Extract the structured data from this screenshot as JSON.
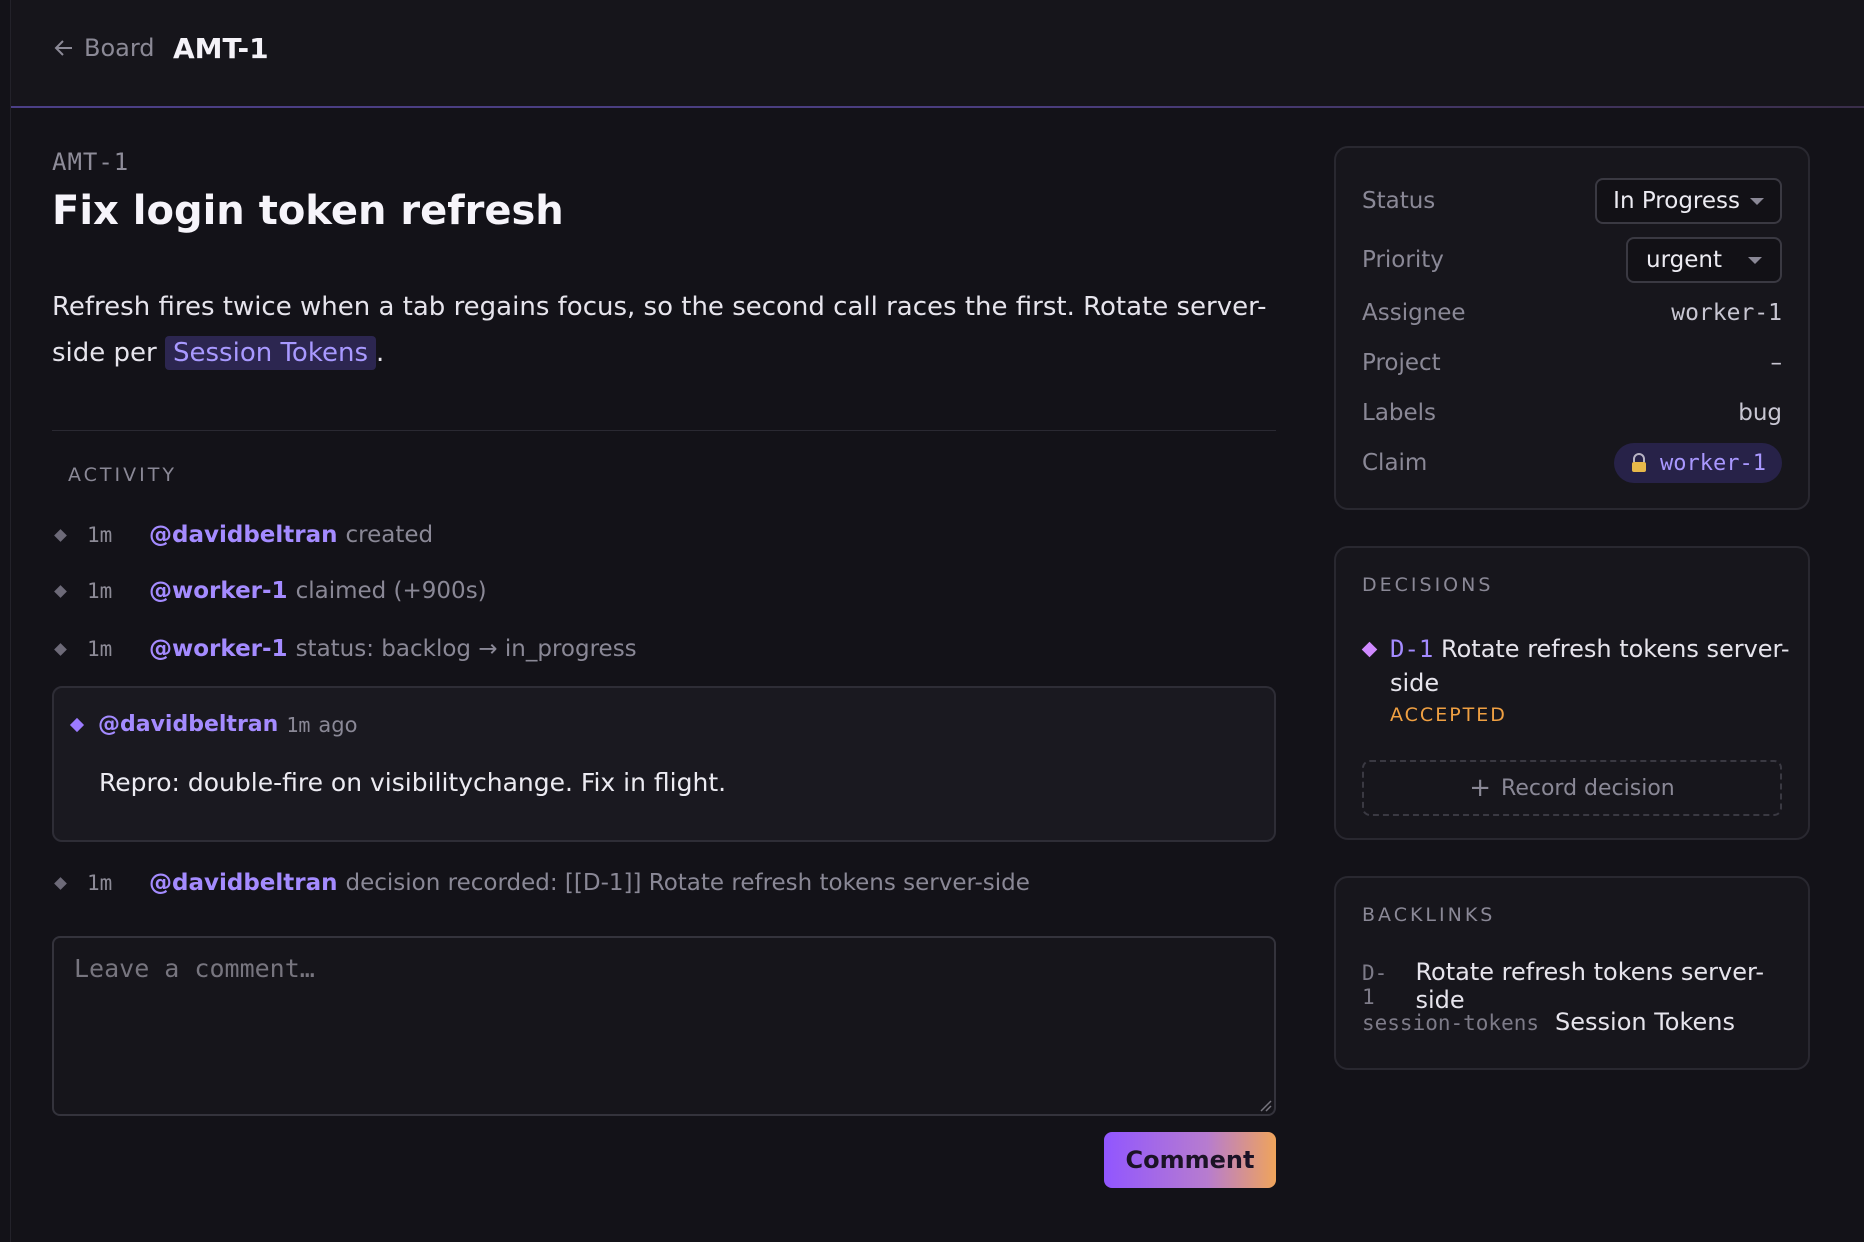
{
  "header": {
    "back_label": "Board",
    "title": "AMT-1"
  },
  "issue": {
    "key": "AMT-1",
    "title": "Fix login token refresh",
    "description_text": "Refresh fires twice when a tab regains focus, so the second call races the first. Rotate server-side per ",
    "description_link": "Session Tokens",
    "description_end": "."
  },
  "activity": {
    "heading": "ACTIVITY",
    "events": [
      {
        "age": "1m",
        "user": "@davidbeltran",
        "text": "created"
      },
      {
        "age": "1m",
        "user": "@worker-1",
        "text": "claimed (+900s)"
      },
      {
        "age": "1m",
        "user": "@worker-1",
        "text": "status: backlog → in_progress"
      },
      {
        "age": "1m",
        "user": "@davidbeltran",
        "text": "decision recorded: [[D-1]] Rotate refresh tokens server-side"
      }
    ],
    "comment": {
      "user": "@davidbeltran",
      "age": "1m",
      "ago": "ago",
      "body": "Repro: double-fire on visibilitychange. Fix in flight."
    }
  },
  "composer": {
    "placeholder": "Leave a comment…",
    "submit_label": "Comment"
  },
  "properties": {
    "status_label": "Status",
    "status_value": "In Progress",
    "priority_label": "Priority",
    "priority_value": "urgent",
    "assignee_label": "Assignee",
    "assignee_value": "worker-1",
    "project_label": "Project",
    "project_value": "–",
    "labels_label": "Labels",
    "labels_value": "bug",
    "claim_label": "Claim",
    "claim_value": "worker-1"
  },
  "decisions": {
    "heading": "DECISIONS",
    "items": [
      {
        "key": "D-1",
        "title": "Rotate refresh tokens server-side",
        "status": "ACCEPTED"
      }
    ],
    "record_label": "Record decision"
  },
  "backlinks": {
    "heading": "BACKLINKS",
    "items": [
      {
        "key": "D-1",
        "title": "Rotate refresh tokens server-side"
      },
      {
        "key": "session-tokens",
        "title": "Session Tokens"
      }
    ]
  },
  "colors": {
    "accent": "#a48bff",
    "accepted": "#f0a042",
    "background": "#131218"
  },
  "icons": [
    "arrow-left-icon",
    "lock-icon",
    "plus-icon",
    "chevron-down-icon",
    "resize-grip-icon"
  ]
}
